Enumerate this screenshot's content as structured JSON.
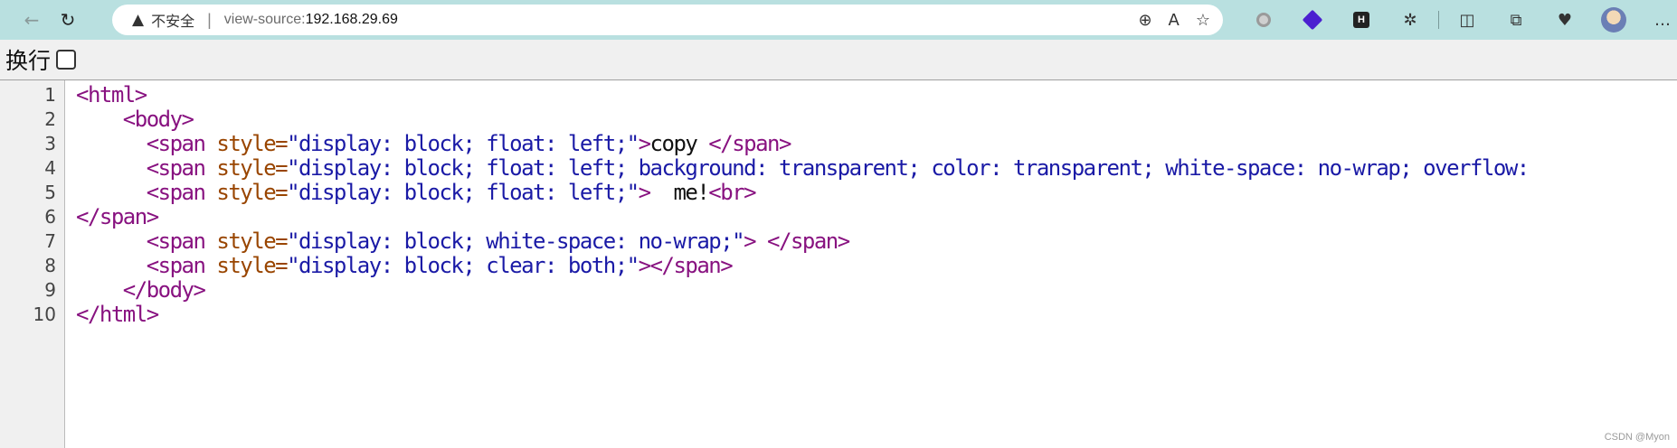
{
  "browser": {
    "back_icon": "←",
    "reload_icon": "↻",
    "address": {
      "warning_icon": "▲",
      "security_label": "不安全",
      "separator": "|",
      "scheme": "view-source:",
      "host": "192.168.29.69"
    },
    "address_actions": {
      "zoom_icon": "⊕",
      "read_aloud_icon": "A",
      "favorite_icon": "☆"
    },
    "toolbar_icons": {
      "extensions_icon": "✲",
      "split_screen_icon": "◫",
      "collections_icon": "⧉",
      "health_icon": "♥",
      "more_icon": "…"
    },
    "ext_h_label": "H"
  },
  "wrap_bar": {
    "label": "换行",
    "checked": false
  },
  "source": {
    "lines": [
      {
        "no": "1",
        "indent": "",
        "parts": [
          [
            "tag",
            "<html>"
          ]
        ]
      },
      {
        "no": "2",
        "indent": "    ",
        "parts": [
          [
            "tag",
            "<body>"
          ]
        ]
      },
      {
        "no": "3",
        "indent": "      ",
        "parts": [
          [
            "tag",
            "<span "
          ],
          [
            "attr",
            "style="
          ],
          [
            "val",
            "\"display: block; float: left;\""
          ],
          [
            "tag",
            ">"
          ],
          [
            "text",
            "copy "
          ],
          [
            "tag",
            "</span>"
          ]
        ]
      },
      {
        "no": "4",
        "indent": "      ",
        "parts": [
          [
            "tag",
            "<span "
          ],
          [
            "attr",
            "style="
          ],
          [
            "val",
            "\"display: block; float: left; background: transparent; color: transparent; white-space: no-wrap; overflow:"
          ]
        ]
      },
      {
        "no": "5",
        "indent": "      ",
        "parts": [
          [
            "tag",
            "<span "
          ],
          [
            "attr",
            "style="
          ],
          [
            "val",
            "\"display: block; float: left;\""
          ],
          [
            "tag",
            ">"
          ],
          [
            "text",
            "  me!"
          ],
          [
            "tag",
            "<br>"
          ]
        ]
      },
      {
        "no": "6",
        "indent": "",
        "parts": [
          [
            "tag",
            "</span>"
          ]
        ]
      },
      {
        "no": "7",
        "indent": "      ",
        "parts": [
          [
            "tag",
            "<span "
          ],
          [
            "attr",
            "style="
          ],
          [
            "val",
            "\"display: block; white-space: no-wrap;\""
          ],
          [
            "tag",
            "> </span>"
          ]
        ]
      },
      {
        "no": "8",
        "indent": "      ",
        "parts": [
          [
            "tag",
            "<span "
          ],
          [
            "attr",
            "style="
          ],
          [
            "val",
            "\"display: block; clear: both;\""
          ],
          [
            "tag",
            "></span>"
          ]
        ]
      },
      {
        "no": "9",
        "indent": "    ",
        "parts": [
          [
            "tag",
            "</body>"
          ]
        ]
      },
      {
        "no": "10",
        "indent": "",
        "parts": [
          [
            "tag",
            "</html>"
          ]
        ]
      }
    ]
  },
  "watermark": "CSDN @Myon⁢",
  "colors": {
    "toolbar_bg": "#b9e0e0",
    "tag": "#881280",
    "attr": "#994500",
    "value": "#1a1aa6"
  }
}
